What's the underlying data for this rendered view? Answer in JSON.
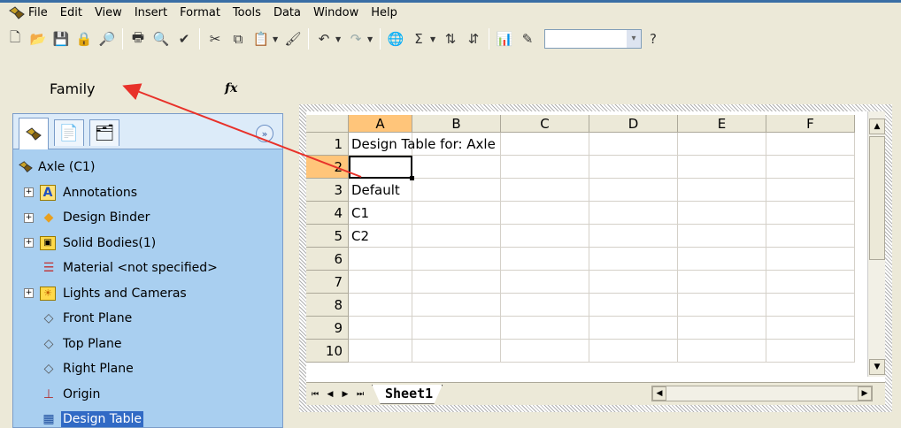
{
  "menu": [
    "File",
    "Edit",
    "View",
    "Insert",
    "Format",
    "Tools",
    "Data",
    "Window",
    "Help"
  ],
  "formula_bar": {
    "name_box_value": "Family",
    "fx_label": "fx"
  },
  "feature_tree": {
    "root": "Axle  (C1)",
    "items": [
      {
        "label": "Annotations",
        "icon": "annotations-icon",
        "expandable": true
      },
      {
        "label": "Design Binder",
        "icon": "design-binder-icon",
        "expandable": true
      },
      {
        "label": "Solid Bodies(1)",
        "icon": "solid-bodies-icon",
        "expandable": true
      },
      {
        "label": "Material <not specified>",
        "icon": "material-icon",
        "expandable": false
      },
      {
        "label": "Lights and Cameras",
        "icon": "lights-icon",
        "expandable": true
      },
      {
        "label": "Front Plane",
        "icon": "plane-icon",
        "expandable": false
      },
      {
        "label": "Top Plane",
        "icon": "plane-icon",
        "expandable": false
      },
      {
        "label": "Right Plane",
        "icon": "plane-icon",
        "expandable": false
      },
      {
        "label": "Origin",
        "icon": "origin-icon",
        "expandable": false
      },
      {
        "label": "Design Table",
        "icon": "design-table-icon",
        "expandable": false,
        "selected": true
      }
    ]
  },
  "spreadsheet": {
    "columns": [
      "A",
      "B",
      "C",
      "D",
      "E",
      "F"
    ],
    "active_column": "A",
    "active_row": "2",
    "rows": [
      {
        "num": "1",
        "a": "Design Table for: Axle"
      },
      {
        "num": "2",
        "a": ""
      },
      {
        "num": "3",
        "a": "Default"
      },
      {
        "num": "4",
        "a": "C1"
      },
      {
        "num": "5",
        "a": "C2"
      },
      {
        "num": "6",
        "a": ""
      },
      {
        "num": "7",
        "a": ""
      },
      {
        "num": "8",
        "a": ""
      },
      {
        "num": "9",
        "a": ""
      },
      {
        "num": "10",
        "a": ""
      }
    ],
    "sheet_tab": "Sheet1"
  },
  "annotation": {
    "arrow_color": "#e8312a"
  },
  "colors": {
    "panel_bg": "#a9cff0",
    "selection": "#316ac5",
    "header_active": "#ffc57a"
  }
}
